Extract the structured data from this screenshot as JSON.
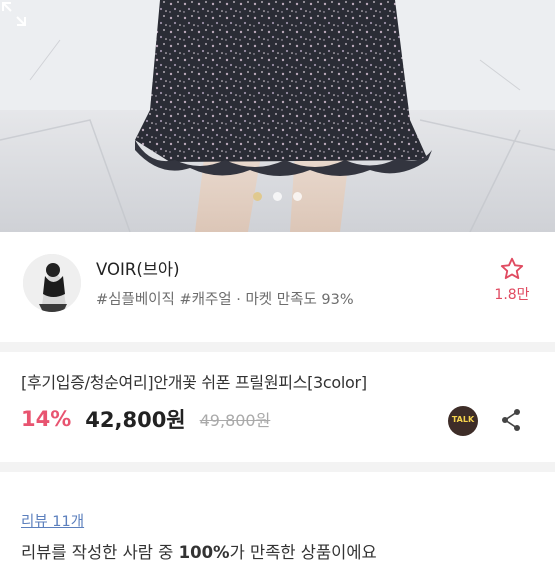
{
  "hero": {
    "image_alt": "product photo",
    "active_dot": 1,
    "dots": 3
  },
  "seller": {
    "name": "VOIR(브아)",
    "tags": "#심플베이직 #캐주얼",
    "separator": " · ",
    "satisfaction": "마켓 만족도 93%",
    "favorite_count": "1.8만"
  },
  "product": {
    "title": "[후기입증/청순여리]안개꽃 쉬폰 프릴원피스[3color]",
    "discount": "14%",
    "price": "42,800원",
    "original_price": "49,800원",
    "talk_label": "TALK"
  },
  "reviews": {
    "link": "리뷰 11개",
    "summary_prefix": "리뷰를 작성한 사람 중 ",
    "summary_percent": "100%",
    "summary_suffix": "가 만족한 상품이에요"
  },
  "colors": {
    "accent_pink": "#e85470",
    "link_blue": "#5b7fbd",
    "talk_bg": "#3e2d28",
    "talk_text": "#f6d44d"
  }
}
